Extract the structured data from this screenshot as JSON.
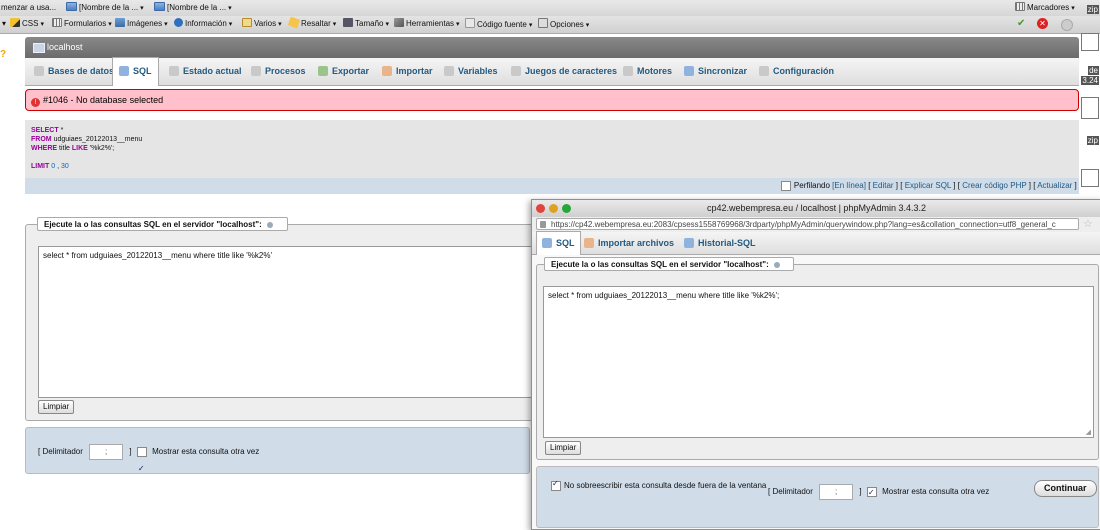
{
  "browser": {
    "bookmarks": {
      "item0": "menzar a usa...",
      "item1": "[Nombre de la ...",
      "item2": "[Nombre de la ...",
      "right": "Marcadores"
    },
    "devtoolbar": [
      "CSS",
      "Formularios",
      "Imágenes",
      "Información",
      "Varios",
      "Resaltar",
      "Tamaño",
      "Herramientas",
      "Código fuente",
      "Opciones"
    ]
  },
  "server": {
    "title": "localhost"
  },
  "tabs": [
    "Bases de datos",
    "SQL",
    "Estado actual",
    "Procesos",
    "Exportar",
    "Importar",
    "Variables",
    "Juegos de caracteres",
    "Motores",
    "Sincronizar",
    "Configuración"
  ],
  "error": {
    "text": "#1046 - No database selected"
  },
  "sql_display": {
    "kw_select": "SELECT",
    "star": "*",
    "kw_from": "FROM",
    "table": "udguiaes_20122013__menu",
    "kw_where": "WHERE",
    "cond": "title",
    "kw_like": "LIKE",
    "pattern": "'%k2%';",
    "kw_limit": "LIMIT",
    "lim0": "0",
    "comma": ",",
    "lim1": "30"
  },
  "profiling": {
    "label": "Perfilando",
    "en_linea": "[En línea]",
    "editar": "Editar",
    "explicar": "Explicar SQL",
    "crear": "Crear código PHP",
    "actualizar": "Actualizar"
  },
  "query_form": {
    "legend": "Ejecute la o las consultas SQL en el servidor \"localhost\":",
    "query": "select * from udguiaes_20122013__menu where title like '%k2%'",
    "clear_button": "Limpiar",
    "delim_label": "[ Delimitador",
    "delim_value": ";",
    "close_bracket": "]",
    "show_again": "Mostrar esta consulta otra vez"
  },
  "popup": {
    "title": "cp42.webempresa.eu / localhost | phpMyAdmin 3.4.3.2",
    "url": "https://cp42.webempresa.eu:2083/cpsess1558769968/3rdparty/phpMyAdmin/querywindow.php?lang=es&collation_connection=utf8_general_c",
    "tabs": [
      "SQL",
      "Importar archivos",
      "Historial-SQL"
    ],
    "legend": "Ejecute la o las consultas SQL en el servidor \"localhost\":",
    "query": "select * from udguiaes_20122013__menu where title like '%k2%';",
    "clear_button": "Limpiar",
    "no_overwrite": "No sobreescribir esta consulta desde fuera de la ventana",
    "delim_label": "[ Delimitador",
    "delim_value": ";",
    "close_bracket": "]",
    "show_again": "Mostrar esta consulta otra vez",
    "submit": "Continuar"
  },
  "side_labels": {
    "a": "zip",
    "b": "de",
    "c": "3.24",
    "d": "zip"
  },
  "colors": {
    "error_bg": "#ffc0cb",
    "link": "#235a81",
    "keyword": "#990099"
  }
}
